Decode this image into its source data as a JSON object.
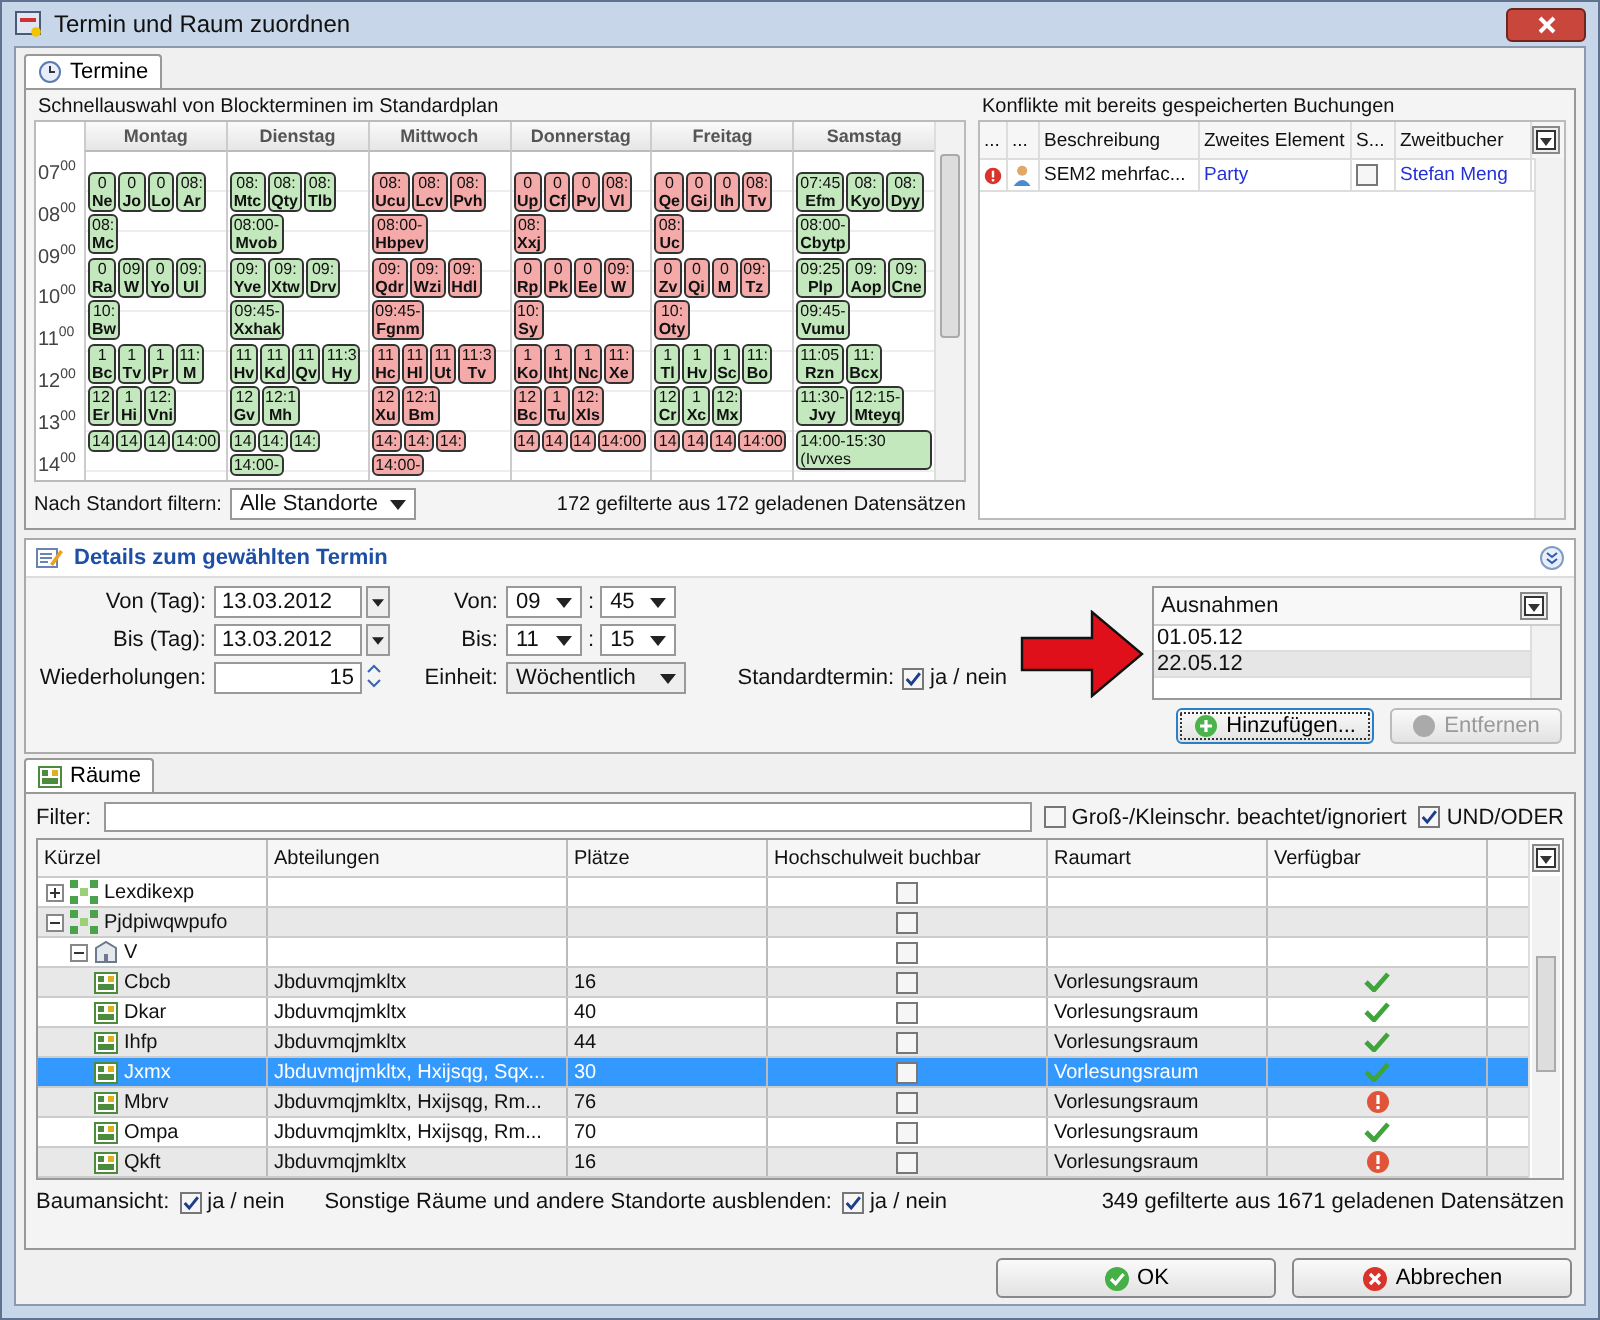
{
  "window": {
    "title": "Termin und Raum zuordnen"
  },
  "top_tab": {
    "label": "Termine",
    "selected": true
  },
  "schedule": {
    "title": "Schnellauswahl von Blockterminen im Standardplan",
    "times": [
      "07$^{00}$",
      "08$^{00}$",
      "09$^{00}$",
      "10$^{00}$",
      "11$^{00}$",
      "12$^{00}$",
      "13$^{00}$",
      "14$^{00}$"
    ],
    "days": [
      {
        "name": "Montag",
        "bands": [
          {
            "color": "#c4e8bd",
            "blocks": [
              {
                "time": "0",
                "name": "Ne"
              },
              {
                "time": "0",
                "name": "Jo"
              },
              {
                "time": "0",
                "name": "Lo"
              },
              {
                "time": "08:",
                "name": "Ar"
              },
              {
                "time": "08:",
                "name": "Mc"
              }
            ]
          },
          {
            "color": "#c4e8bd",
            "blocks": [
              {
                "time": "0",
                "name": "Ra"
              },
              {
                "time": "09",
                "name": "W"
              },
              {
                "time": "0",
                "name": "Yo"
              },
              {
                "time": "09:",
                "name": "Ul"
              },
              {
                "time": "10:",
                "name": "Bw"
              }
            ]
          },
          {
            "color": "#c4e8bd",
            "blocks": [
              {
                "time": "1",
                "name": "Bc"
              },
              {
                "time": "1",
                "name": "Tv"
              },
              {
                "time": "1",
                "name": "Pr"
              },
              {
                "time": "11:",
                "name": "M"
              },
              {
                "time": "12",
                "name": "Er"
              },
              {
                "time": "1",
                "name": "Hi"
              },
              {
                "time": "12:",
                "name": "Vni"
              }
            ]
          },
          {
            "color": "#c4e8bd",
            "blocks": [
              {
                "time": "14"
              },
              {
                "time": "14"
              },
              {
                "time": "14"
              },
              {
                "time": "14:00"
              }
            ]
          }
        ]
      },
      {
        "name": "Dienstag",
        "bands": [
          {
            "color": "#c4e8bd",
            "blocks": [
              {
                "time": "08:",
                "name": "Mtc"
              },
              {
                "time": "08:",
                "name": "Qty"
              },
              {
                "time": "08:",
                "name": "Tlb"
              },
              {
                "time": "08:00-",
                "name": "Mvob"
              }
            ]
          },
          {
            "color": "#c4e8bd",
            "blocks": [
              {
                "time": "09:",
                "name": "Yve"
              },
              {
                "time": "09:",
                "name": "Xtw"
              },
              {
                "time": "09:",
                "name": "Drv"
              },
              {
                "time": "09:45-",
                "name": "Xxhak"
              }
            ]
          },
          {
            "color": "#c4e8bd",
            "blocks": [
              {
                "time": "11",
                "name": "Hv"
              },
              {
                "time": "11",
                "name": "Kd"
              },
              {
                "time": "11",
                "name": "Qv"
              },
              {
                "time": "11:3",
                "name": "Hy"
              },
              {
                "time": "12",
                "name": "Gv"
              },
              {
                "time": "12:1",
                "name": "Mh"
              }
            ]
          },
          {
            "color": "#c4e8bd",
            "blocks": [
              {
                "time": "14"
              },
              {
                "time": "14:"
              },
              {
                "time": "14:"
              },
              {
                "time": "14:00-"
              }
            ]
          }
        ]
      },
      {
        "name": "Mittwoch",
        "bands": [
          {
            "color": "#f5aaaa",
            "blocks": [
              {
                "time": "08:",
                "name": "Ucu"
              },
              {
                "time": "08:",
                "name": "Lcv"
              },
              {
                "time": "08:",
                "name": "Pvh"
              },
              {
                "time": "08:00-",
                "name": "Hbpev"
              }
            ]
          },
          {
            "color": "#f5aaaa",
            "blocks": [
              {
                "time": "09:",
                "name": "Qdr"
              },
              {
                "time": "09:",
                "name": "Wzi"
              },
              {
                "time": "09:",
                "name": "Hdl"
              },
              {
                "time": "09:45-",
                "name": "Fgnm"
              }
            ]
          },
          {
            "color": "#f5aaaa",
            "blocks": [
              {
                "time": "11",
                "name": "Hc"
              },
              {
                "time": "11",
                "name": "Hl"
              },
              {
                "time": "11",
                "name": "Ut"
              },
              {
                "time": "11:3",
                "name": "Tv"
              },
              {
                "time": "12",
                "name": "Xu"
              },
              {
                "time": "12:1",
                "name": "Bm"
              }
            ]
          },
          {
            "color": "#f5aaaa",
            "blocks": [
              {
                "time": "14:"
              },
              {
                "time": "14:"
              },
              {
                "time": "14:"
              },
              {
                "time": "14:00-"
              }
            ]
          }
        ]
      },
      {
        "name": "Donnerstag",
        "bands": [
          {
            "color": "#f5aaaa",
            "blocks": [
              {
                "time": "0",
                "name": "Up"
              },
              {
                "time": "0",
                "name": "Cf"
              },
              {
                "time": "0",
                "name": "Pv"
              },
              {
                "time": "08:",
                "name": "Vl"
              },
              {
                "time": "08:",
                "name": "Xxj"
              }
            ]
          },
          {
            "color": "#f5aaaa",
            "blocks": [
              {
                "time": "0",
                "name": "Rp"
              },
              {
                "time": "0",
                "name": "Pk"
              },
              {
                "time": "0",
                "name": "Ee"
              },
              {
                "time": "09:",
                "name": "W"
              },
              {
                "time": "10:",
                "name": "Sy"
              }
            ]
          },
          {
            "color": "#f5aaaa",
            "blocks": [
              {
                "time": "1",
                "name": "Ko"
              },
              {
                "time": "1",
                "name": "Iht"
              },
              {
                "time": "1",
                "name": "Nc"
              },
              {
                "time": "11:",
                "name": "Xe"
              },
              {
                "time": "12",
                "name": "Bc"
              },
              {
                "time": "1",
                "name": "Tu"
              },
              {
                "time": "12:",
                "name": "Xls"
              }
            ]
          },
          {
            "color": "#f5aaaa",
            "blocks": [
              {
                "time": "14"
              },
              {
                "time": "14"
              },
              {
                "time": "14"
              },
              {
                "time": "14:00"
              }
            ]
          }
        ]
      },
      {
        "name": "Freitag",
        "bands": [
          {
            "color": "#f5aaaa",
            "blocks": [
              {
                "time": "0",
                "name": "Qe"
              },
              {
                "time": "0",
                "name": "Gi"
              },
              {
                "time": "0",
                "name": "Ih"
              },
              {
                "time": "08:",
                "name": "Tv"
              },
              {
                "time": "08:",
                "name": "Uc"
              }
            ]
          },
          {
            "color": "#f5aaaa",
            "blocks": [
              {
                "time": "0",
                "name": "Zv"
              },
              {
                "time": "0",
                "name": "Qi"
              },
              {
                "time": "0",
                "name": "M"
              },
              {
                "time": "09:",
                "name": "Tz"
              },
              {
                "time": "10:",
                "name": "Oty"
              }
            ]
          },
          {
            "color": "#c4e8bd",
            "blocks": [
              {
                "time": "1",
                "name": "Tl"
              },
              {
                "time": "1",
                "name": "Hv"
              },
              {
                "time": "1",
                "name": "Sc"
              },
              {
                "time": "11:",
                "name": "Bo"
              },
              {
                "time": "12",
                "name": "Cr"
              },
              {
                "time": "1",
                "name": "Xc"
              },
              {
                "time": "12:",
                "name": "Mx"
              }
            ]
          },
          {
            "color": "#f5aaaa",
            "blocks": [
              {
                "time": "14"
              },
              {
                "time": "14"
              },
              {
                "time": "14"
              },
              {
                "time": "14:00"
              }
            ]
          }
        ]
      },
      {
        "name": "Samstag",
        "bands": [
          {
            "color": "#c4e8bd",
            "blocks": [
              {
                "time": "07:45",
                "name": "Efm"
              },
              {
                "time": "08:",
                "name": "Kyo"
              },
              {
                "time": "08:",
                "name": "Dyy"
              },
              {
                "time": "08:00-",
                "name": "Cbytp"
              }
            ]
          },
          {
            "color": "#c4e8bd",
            "blocks": [
              {
                "time": "09:25",
                "name": "Plp"
              },
              {
                "time": "09:",
                "name": "Aop"
              },
              {
                "time": "09:",
                "name": "Cne"
              },
              {
                "time": "09:45-",
                "name": "Vumu"
              }
            ]
          },
          {
            "color": "#c4e8bd",
            "blocks": [
              {
                "time": "11:05",
                "name": "Rzn"
              },
              {
                "time": "11:",
                "name": "Bcx"
              },
              {
                "time": "11:30-",
                "name": "Jvy"
              },
              {
                "time": "12:15-",
                "name": "Mteyq"
              }
            ]
          },
          {
            "color": "#c4e8bd",
            "blocks": [
              {
                "time": "14:00-15:30 (Ivvxes"
              }
            ]
          }
        ]
      }
    ],
    "filter_label": "Nach Standort filtern:",
    "filter_value": "Alle Standorte",
    "count": "172 gefilterte aus 172 geladenen Datensätzen"
  },
  "conflicts": {
    "title": "Konflikte mit bereits gespeicherten Buchungen",
    "columns": [
      "...",
      "...",
      "Beschreibung",
      "Zweites Element",
      "S...",
      "Zweitbucher"
    ],
    "rows": [
      {
        "description": "SEM2 mehrfac...",
        "second_element": "Party",
        "checked": false,
        "second_booker": "Stefan Meng"
      }
    ]
  },
  "details": {
    "title": "Details zum gewählten Termin",
    "from_day_label": "Von (Tag):",
    "from_day": "13.03.2012",
    "to_day_label": "Bis (Tag):",
    "to_day": "13.03.2012",
    "repeat_label": "Wiederholungen:",
    "repeat": "15",
    "from_label": "Von:",
    "from_hour": "09",
    "from_sep": ":",
    "from_minute": "45",
    "to_label": "Bis:",
    "to_hour": "11",
    "to_sep": ":",
    "to_minute": "15",
    "unit_label": "Einheit:",
    "unit": "Wöchentlich",
    "standard_label": "Standardtermin:",
    "standard_checked": true,
    "standard_text": "ja / nein",
    "exceptions": {
      "header": "Ausnahmen",
      "items": [
        {
          "date": "01.05.12",
          "selected": false
        },
        {
          "date": "22.05.12",
          "selected": true
        }
      ]
    },
    "add_button": "Hinzufügen...",
    "remove_button": {
      "label": "Entfernen",
      "disabled": true
    }
  },
  "rooms": {
    "tab": {
      "label": "Räume",
      "selected": true
    },
    "filter_label": "Filter:",
    "case_option": {
      "label": "Groß-/Kleinschr. beachtet/ignoriert",
      "checked": false
    },
    "andor_option": {
      "label": "UND/ODER",
      "checked": true
    },
    "columns": [
      "Kürzel",
      "Abteilungen",
      "Plätze",
      "Hochschulweit buchbar",
      "Raumart",
      "Verfügbar"
    ],
    "rows": [
      {
        "kind": "site",
        "name": "Lexdikexp",
        "expanded": false,
        "bookable": false,
        "selected": false
      },
      {
        "kind": "site",
        "name": "Pjdpiwqwpufo",
        "expanded": true,
        "bookable": false,
        "selected": false,
        "children": [
          {
            "kind": "building",
            "name": "V",
            "expanded": true,
            "bookable": false,
            "selected": false,
            "children": [
              {
                "kind": "room",
                "name": "Cbcb",
                "departments": "Jbduvmqjmkltx",
                "seats": "16",
                "bookable": false,
                "room_type": "Vorlesungsraum",
                "available": true,
                "selected": false
              },
              {
                "kind": "room",
                "name": "Dkar",
                "departments": "Jbduvmqjmkltx",
                "seats": "40",
                "bookable": false,
                "room_type": "Vorlesungsraum",
                "available": true,
                "selected": false
              },
              {
                "kind": "room",
                "name": "Ihfp",
                "departments": "Jbduvmqjmkltx",
                "seats": "44",
                "bookable": false,
                "room_type": "Vorlesungsraum",
                "available": true,
                "selected": false
              },
              {
                "kind": "room",
                "name": "Jxmx",
                "departments": "Jbduvmqjmkltx, Hxijsqg, Sqx...",
                "seats": "30",
                "bookable": false,
                "room_type": "Vorlesungsraum",
                "available": true,
                "selected": true
              },
              {
                "kind": "room",
                "name": "Mbrv",
                "departments": "Jbduvmqjmkltx, Hxijsqg, Rm...",
                "seats": "76",
                "bookable": false,
                "room_type": "Vorlesungsraum",
                "available": false,
                "selected": false
              },
              {
                "kind": "room",
                "name": "Ompa",
                "departments": "Jbduvmqjmkltx, Hxijsqg, Rm...",
                "seats": "70",
                "bookable": false,
                "room_type": "Vorlesungsraum",
                "available": true,
                "selected": false
              },
              {
                "kind": "room",
                "name": "Qkft",
                "departments": "Jbduvmqjmkltx",
                "seats": "16",
                "bookable": false,
                "room_type": "Vorlesungsraum",
                "available": false,
                "selected": false
              }
            ]
          }
        ]
      }
    ],
    "tree_option": {
      "label": "Baumansicht:",
      "checked": true,
      "text": "ja / nein"
    },
    "hide_option": {
      "label": "Sonstige Räume und andere Standorte ausblenden:",
      "checked": true,
      "text": "ja / nein"
    },
    "count": "349 gefilterte aus 1671 geladenen Datensätzen"
  },
  "buttons": [
    {
      "label": "OK",
      "kind": "ok"
    },
    {
      "label": "Abbrechen",
      "kind": "cancel"
    }
  ]
}
